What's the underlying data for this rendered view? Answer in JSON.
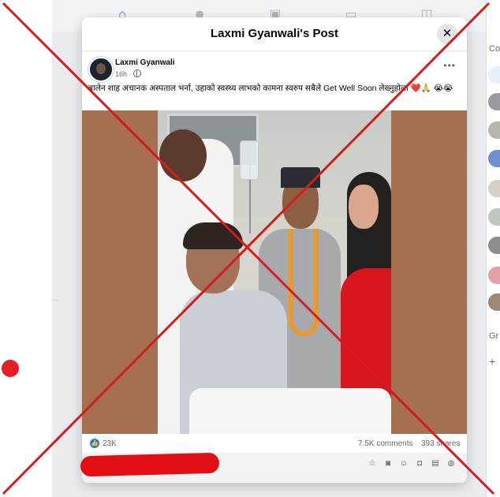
{
  "post": {
    "modal_title": "Laxmi Gyanwali's Post",
    "close_glyph": "✕",
    "author": "Laxmi Gyanwali",
    "time": "16h ·",
    "more_glyph": "•••",
    "caption": "बालेन शाह अचानक अस्पताल भर्ना, उहाको स्वस्थ्य लाभको कामना स्वरुप सबैले Get Well Soon लेख्नुहोला ❤️🙏 😭😭",
    "like_glyph": "👍",
    "likes": "23K",
    "comments": "7.5K comments",
    "shares": "393 shares"
  },
  "sidebar_right": {
    "contacts_label": "Co",
    "groups_label": "Gr",
    "add_glyph": "+"
  },
  "nav_icons": [
    "home-icon",
    "friends-icon",
    "marketplace-icon",
    "watch-icon",
    "gaming-icon"
  ],
  "comment_icons": [
    "sticker-icon",
    "gif-icon",
    "emoji-icon",
    "camera-icon",
    "photo-icon",
    "avatar-sticker-icon"
  ],
  "colors": {
    "accent": "#1877f2",
    "x_overlay": "#d41c1c",
    "redaction": "#e10f14",
    "photo_frame": "#a47051"
  }
}
